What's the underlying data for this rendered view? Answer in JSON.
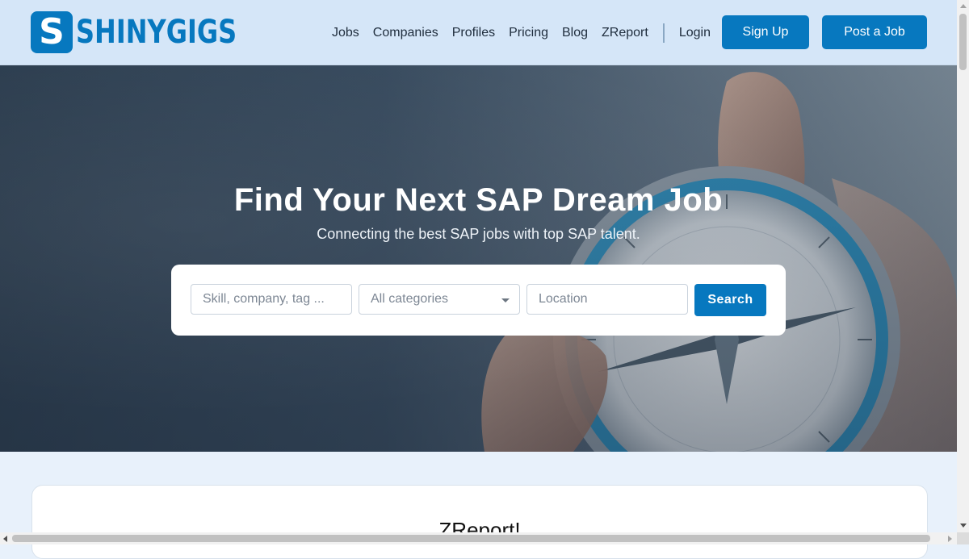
{
  "brand": {
    "logo_letter": "S",
    "logo_text": "SHINYGIGS",
    "color": "#0778bf"
  },
  "nav": {
    "links": [
      "Jobs",
      "Companies",
      "Profiles",
      "Pricing",
      "Blog",
      "ZReport"
    ],
    "login": "Login",
    "signup": "Sign Up",
    "post_job": "Post a Job"
  },
  "hero": {
    "title": "Find Your Next SAP Dream Job",
    "subtitle": "Connecting the best SAP jobs with top SAP talent."
  },
  "search": {
    "skill_placeholder": "Skill, company, tag ...",
    "category_value": "All categories",
    "location_placeholder": "Location",
    "button": "Search"
  },
  "section": {
    "title": "ZReport!"
  }
}
